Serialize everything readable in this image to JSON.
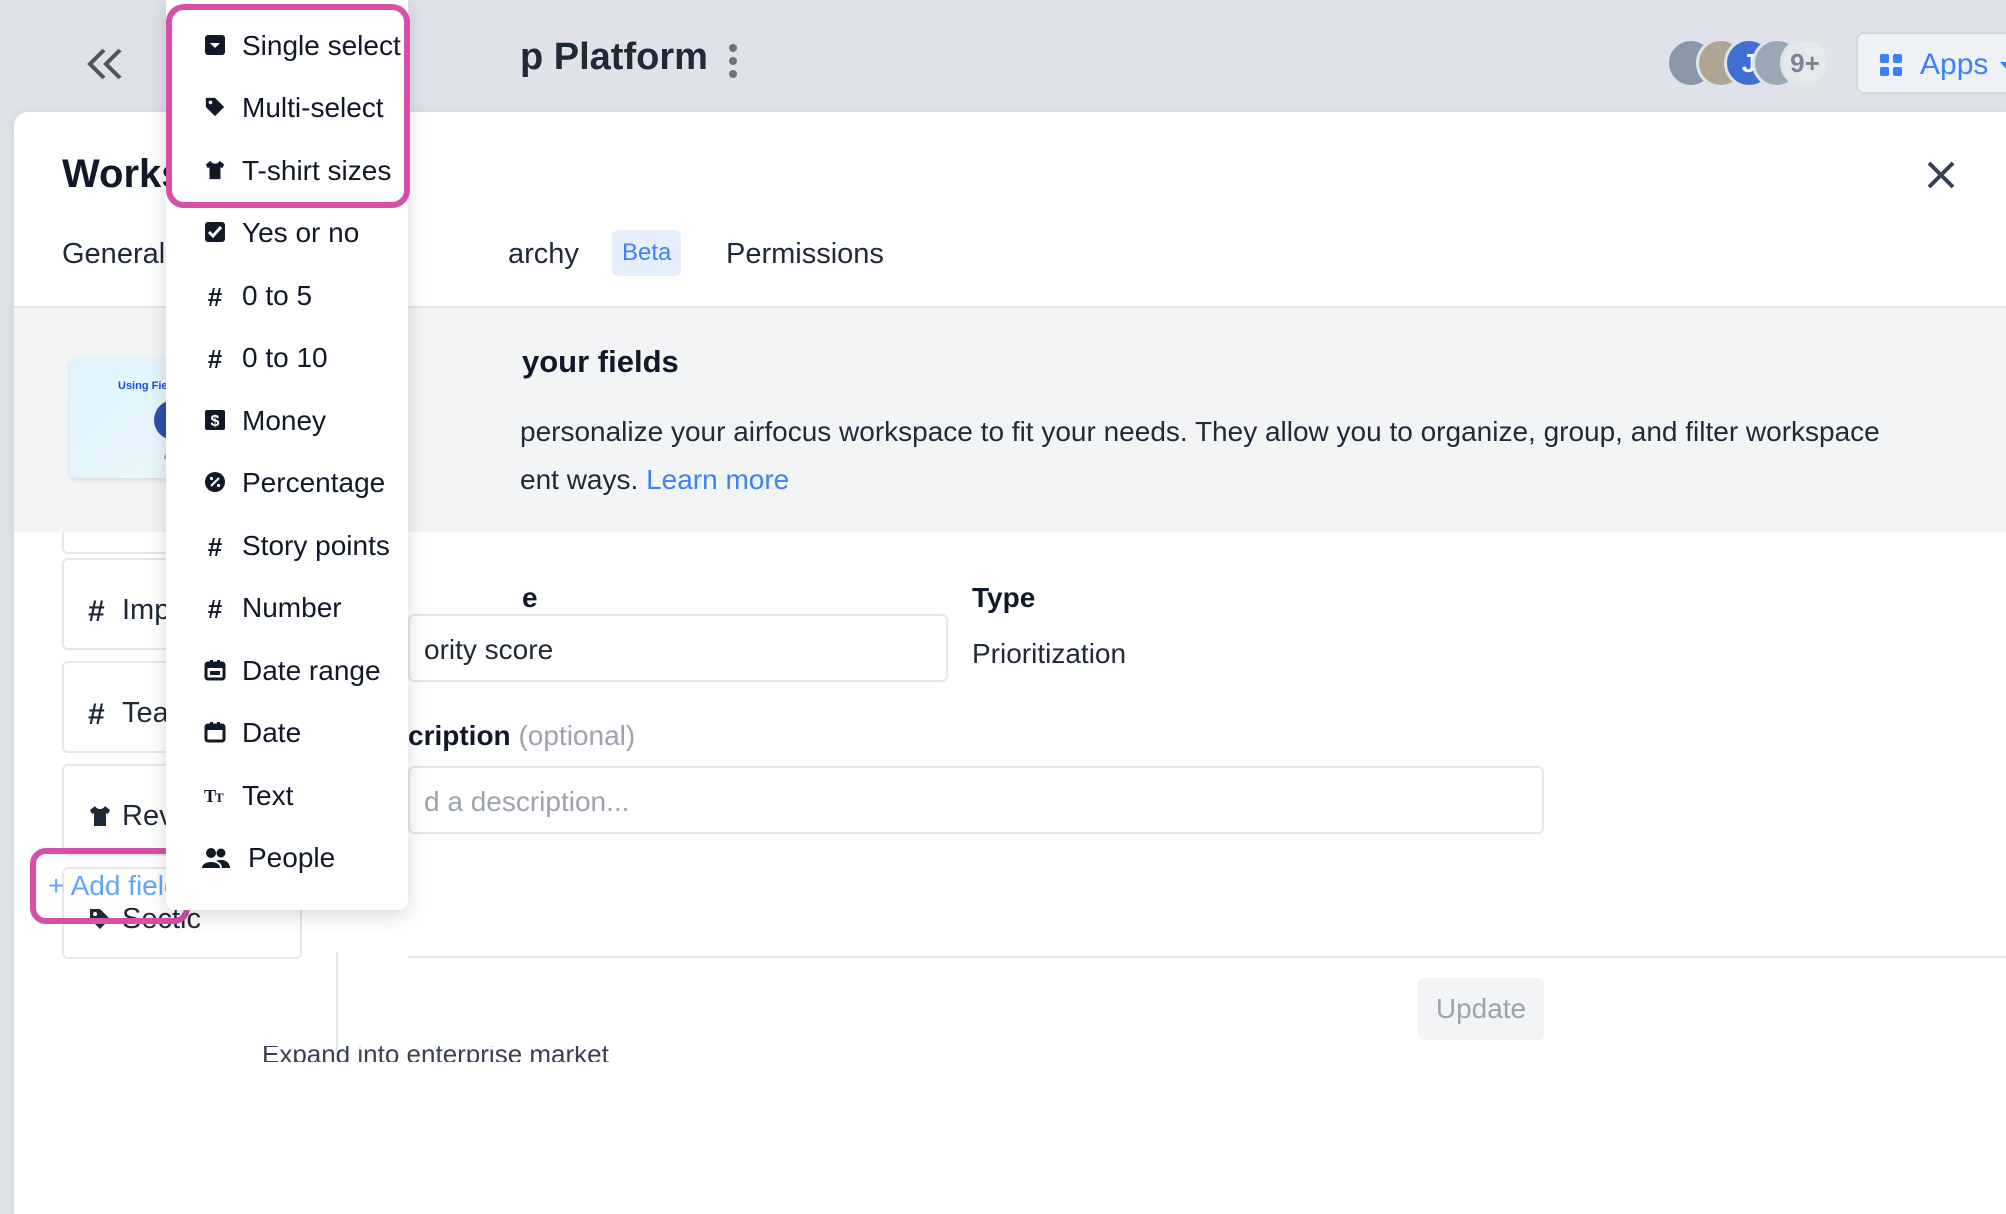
{
  "header": {
    "title": "p Platform",
    "avatars_more": "9+",
    "avatar_initial": "J",
    "apps_label": "Apps"
  },
  "modal": {
    "title": "Workspa",
    "tabs": {
      "general": "General",
      "hierarchy": "archy",
      "beta": "Beta",
      "permissions": "Permissions"
    },
    "banner": {
      "video_text": "Using Fields in airf",
      "video_brand": "airfocus",
      "title": "your fields",
      "text_line1": "personalize your airfocus workspace to fit your needs. They allow you to organize, group, and filter workspace",
      "text_line2": "ent ways. ",
      "learn_more": "Learn more"
    },
    "fields": [
      {
        "label": "Impac",
        "icon": "#"
      },
      {
        "label": "Team",
        "icon": "#"
      },
      {
        "label": "Reven",
        "icon": "t-shirt-icon"
      },
      {
        "label": "Sectic",
        "icon": "tag-icon"
      }
    ],
    "form": {
      "name_label": "e",
      "name_value": "ority score",
      "type_label": "Type",
      "type_value": "Prioritization",
      "desc_label": "cription",
      "desc_optional": "(optional)",
      "desc_placeholder": "d a description..."
    },
    "update_label": "Update",
    "bottom_cut_text": "Expand into enterprise market",
    "add_field_label": "+ Add field"
  },
  "dropdown": {
    "items": [
      {
        "label": "Single select",
        "icon": "single-select-icon"
      },
      {
        "label": "Multi-select",
        "icon": "tag-icon"
      },
      {
        "label": "T-shirt sizes",
        "icon": "t-shirt-icon"
      },
      {
        "label": "Yes or no",
        "icon": "checkbox-icon"
      },
      {
        "label": "0 to 5",
        "icon": "hash-icon"
      },
      {
        "label": "0 to 10",
        "icon": "hash-icon"
      },
      {
        "label": "Money",
        "icon": "dollar-icon"
      },
      {
        "label": "Percentage",
        "icon": "percent-icon"
      },
      {
        "label": "Story points",
        "icon": "hash-icon"
      },
      {
        "label": "Number",
        "icon": "hash-icon"
      },
      {
        "label": "Date range",
        "icon": "calendar-range-icon"
      },
      {
        "label": "Date",
        "icon": "calendar-icon"
      },
      {
        "label": "Text",
        "icon": "text-icon"
      },
      {
        "label": "People",
        "icon": "people-icon"
      }
    ]
  },
  "colors": {
    "accent": "#3b82f6",
    "highlight": "#d64fa8"
  }
}
